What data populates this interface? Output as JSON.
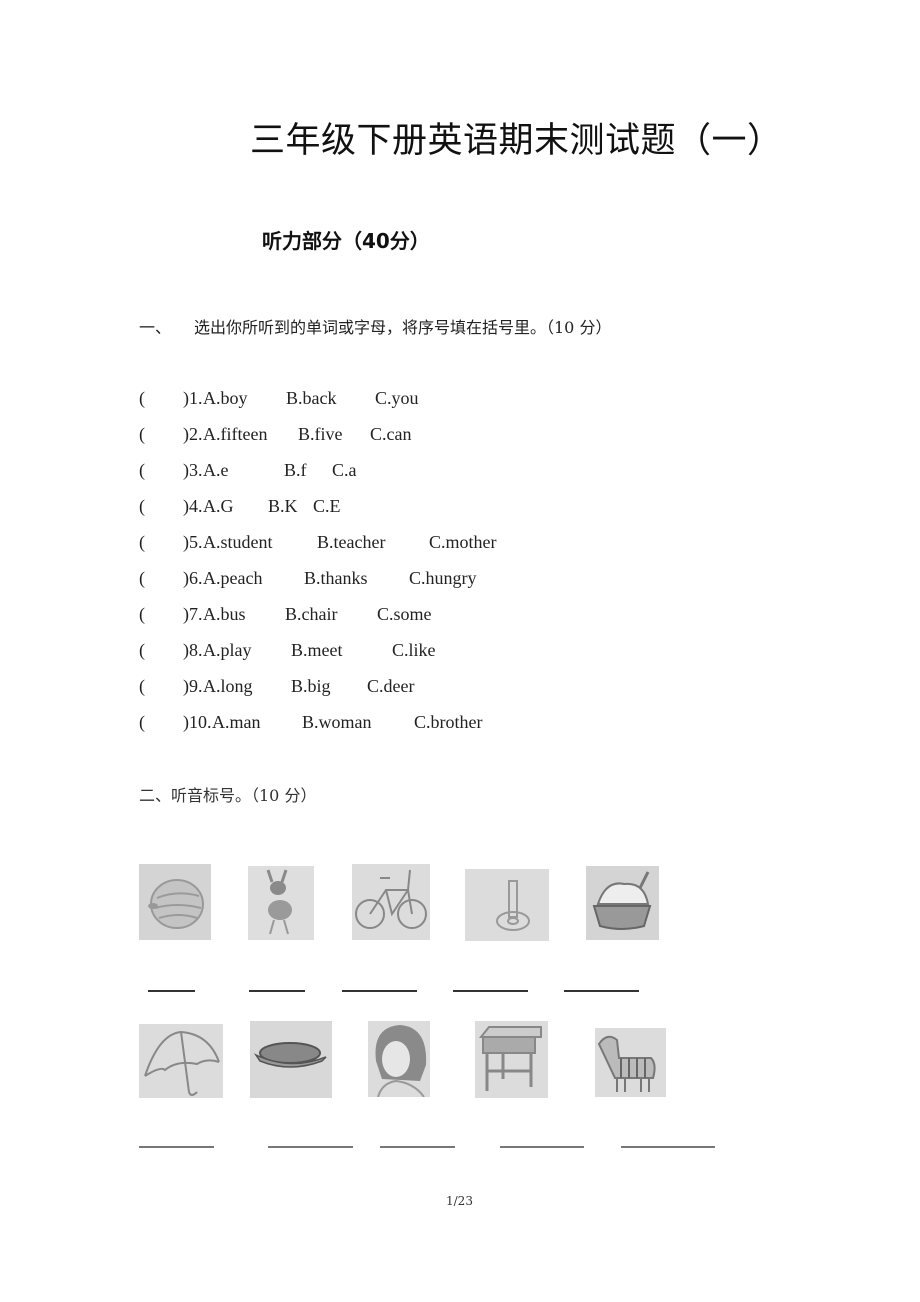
{
  "title": "三年级下册英语期末测试题（一）",
  "subtitle": "听力部分（40分）",
  "section1": {
    "number": "一、",
    "instruction": "选出你所听到的单词或字母，将序号填在括号里。（10 分）",
    "questions": [
      {
        "num": "1",
        "a": "A.boy",
        "b": "B.back",
        "c": "C.you"
      },
      {
        "num": "2",
        "a": "A.fifteen",
        "b": "B.five",
        "c": "C.can"
      },
      {
        "num": "3",
        "a": "A.e",
        "b": "B.f",
        "c": "C.a"
      },
      {
        "num": "4",
        "a": "A.G",
        "b": "B.K",
        "c": "C.E"
      },
      {
        "num": "5",
        "a": "A.student",
        "b": "B.teacher",
        "c": "C.mother"
      },
      {
        "num": "6",
        "a": "A.peach",
        "b": "B.thanks",
        "c": "C.hungry"
      },
      {
        "num": "7",
        "a": "A.bus",
        "b": "B.chair",
        "c": "C.some"
      },
      {
        "num": "8",
        "a": "A.play",
        "b": "B.meet",
        "c": "C.like"
      },
      {
        "num": "9",
        "a": "A.long",
        "b": "B.big",
        "c": "C.deer"
      },
      {
        "num": "10",
        "a": "A.man",
        "b": "B.woman",
        "c": "C.brother"
      }
    ]
  },
  "section2": {
    "instruction": "二、听音标号。（10 分）",
    "pictures_row1": [
      "watermelon",
      "ant",
      "bicycle",
      "key",
      "ice-cream"
    ],
    "pictures_row2": [
      "umbrella",
      "hamburger",
      "woman",
      "desk",
      "zebra"
    ]
  },
  "footer": {
    "page": "1/23"
  }
}
